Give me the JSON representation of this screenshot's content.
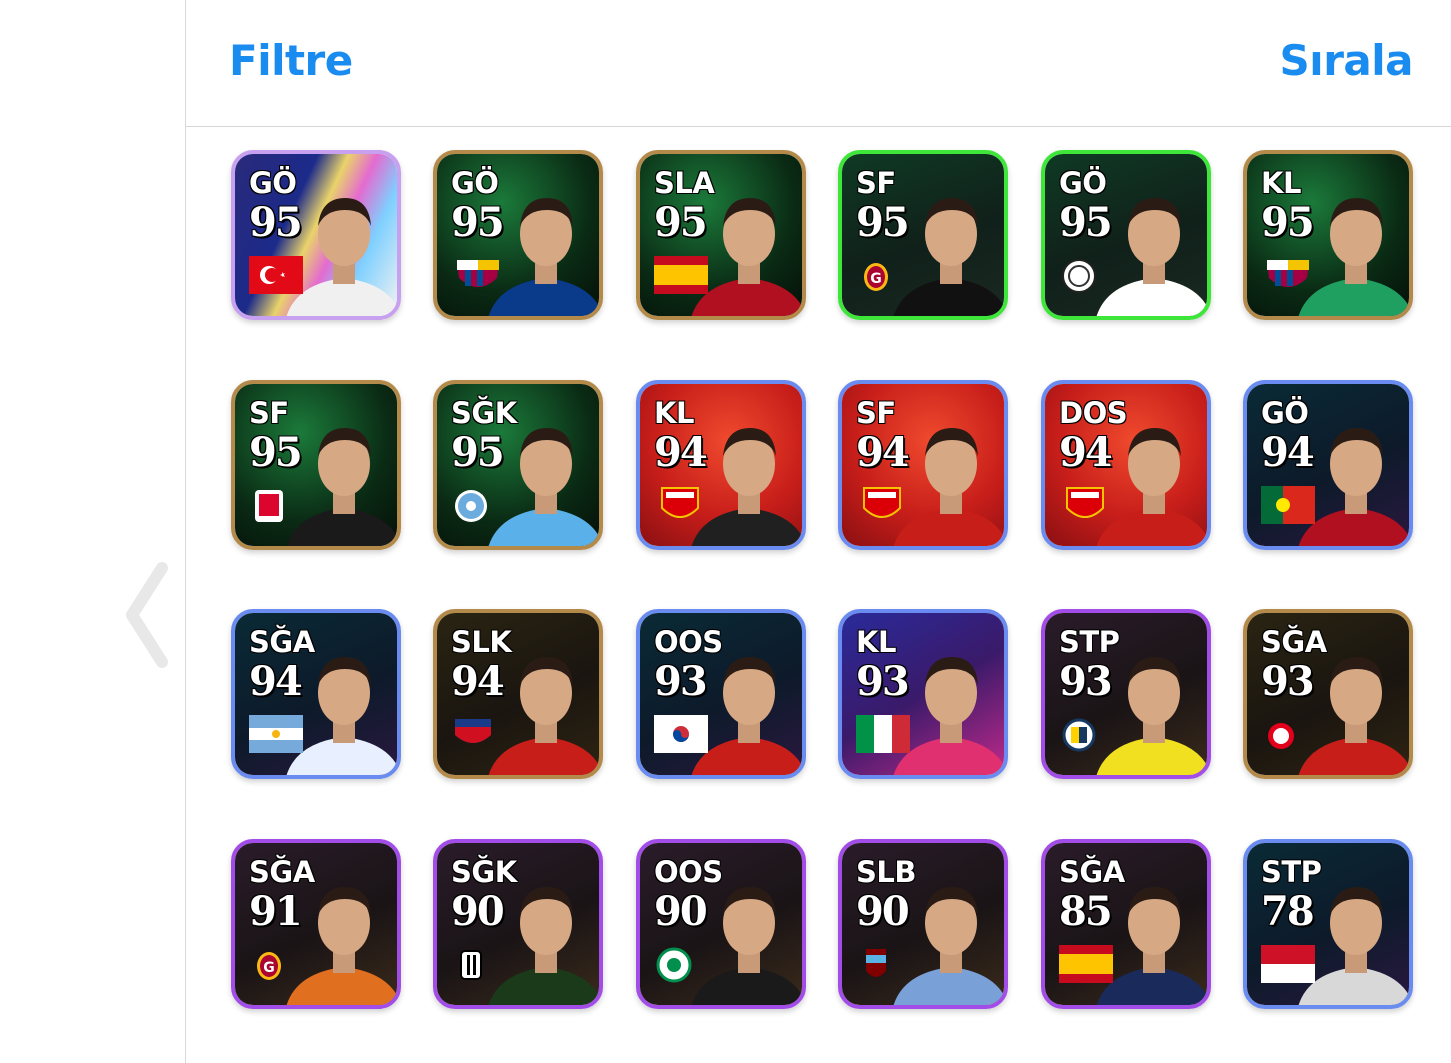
{
  "header": {
    "filter_label": "Filtre",
    "sort_label": "Sırala"
  },
  "nav": {
    "back_icon": "chevron-left-icon"
  },
  "colors": {
    "accent": "#1a8cf0",
    "divider": "#d6d6d6"
  },
  "cards": [
    {
      "pos": "GÖ",
      "rating": "95",
      "badge": "flag-turkey",
      "theme": "purple-multicolor"
    },
    {
      "pos": "GÖ",
      "rating": "95",
      "badge": "club-barcelona",
      "theme": "green-dark"
    },
    {
      "pos": "SLA",
      "rating": "95",
      "badge": "flag-spain",
      "theme": "green-dark"
    },
    {
      "pos": "SF",
      "rating": "95",
      "badge": "club-galatasaray",
      "theme": "dark-green"
    },
    {
      "pos": "GÖ",
      "rating": "95",
      "badge": "club-crest-white",
      "theme": "dark-green"
    },
    {
      "pos": "KL",
      "rating": "95",
      "badge": "club-barcelona",
      "theme": "green-dark"
    },
    {
      "pos": "SF",
      "rating": "95",
      "badge": "club-crest-red",
      "theme": "green-dark"
    },
    {
      "pos": "SĞK",
      "rating": "95",
      "badge": "club-crest-blue",
      "theme": "green-dark"
    },
    {
      "pos": "KL",
      "rating": "94",
      "badge": "club-arsenal",
      "theme": "red"
    },
    {
      "pos": "SF",
      "rating": "94",
      "badge": "club-arsenal",
      "theme": "red"
    },
    {
      "pos": "DOS",
      "rating": "94",
      "badge": "club-arsenal",
      "theme": "red"
    },
    {
      "pos": "GÖ",
      "rating": "94",
      "badge": "flag-portugal",
      "theme": "teal-dark"
    },
    {
      "pos": "SĞA",
      "rating": "94",
      "badge": "flag-argentina",
      "theme": "teal-dark"
    },
    {
      "pos": "SLK",
      "rating": "94",
      "badge": "club-crest-mdrw",
      "theme": "gold-dark"
    },
    {
      "pos": "OOS",
      "rating": "93",
      "badge": "flag-korea",
      "theme": "teal-dark"
    },
    {
      "pos": "KL",
      "rating": "93",
      "badge": "flag-italy",
      "theme": "blue-dark"
    },
    {
      "pos": "STP",
      "rating": "93",
      "badge": "club-fenerbahce",
      "theme": "purple-dark"
    },
    {
      "pos": "SĞA",
      "rating": "93",
      "badge": "club-benfica",
      "theme": "gold-dark"
    },
    {
      "pos": "SĞA",
      "rating": "91",
      "badge": "club-galatasaray",
      "theme": "purple-dark"
    },
    {
      "pos": "SĞK",
      "rating": "90",
      "badge": "club-besiktas",
      "theme": "purple-dark"
    },
    {
      "pos": "OOS",
      "rating": "90",
      "badge": "club-rizespor",
      "theme": "purple-dark"
    },
    {
      "pos": "SLB",
      "rating": "90",
      "badge": "club-trabzonspor",
      "theme": "purple-dark"
    },
    {
      "pos": "SĞA",
      "rating": "85",
      "badge": "flag-spain",
      "theme": "purple-dark"
    },
    {
      "pos": "STP",
      "rating": "78",
      "badge": "flag-indonesia",
      "theme": "teal-dark"
    }
  ]
}
